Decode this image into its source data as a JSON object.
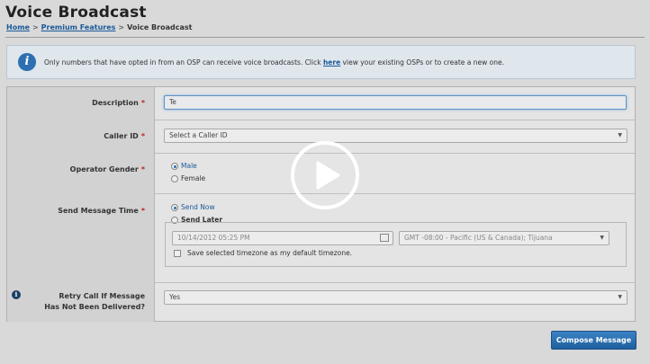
{
  "page": {
    "title": "Voice Broadcast",
    "breadcrumb": {
      "home": "Home",
      "features": "Premium Features",
      "current": "Voice Broadcast",
      "separator": ">"
    }
  },
  "info": {
    "icon": "info-icon",
    "text_before": "Only numbers that have opted in from an OSP can receive voice broadcasts. Click ",
    "link": "here",
    "text_after": " view your existing OSPs or to create a new one."
  },
  "form": {
    "required_mark": "*",
    "description": {
      "label": "Description",
      "value": "Te"
    },
    "caller_id": {
      "label": "Caller ID",
      "value": "Select a Caller ID"
    },
    "gender": {
      "label": "Operator Gender",
      "options": [
        "Male",
        "Female"
      ],
      "selected": "Male"
    },
    "send_time": {
      "label": "Send Message Time",
      "options": [
        "Send Now",
        "Send Later"
      ],
      "selected": "Send Now",
      "datetime": "10/14/2012 05:25 PM",
      "timezone": "GMT -08:00 - Pacific (US & Canada); Tijuana",
      "save_timezone_label": "Save selected timezone as my default timezone."
    },
    "retry": {
      "label_line1": "Retry Call If Message",
      "label_line2": "Has Not Been Delivered?",
      "value": "Yes"
    }
  },
  "actions": {
    "compose": "Compose Message"
  },
  "overlay": {
    "icon": "play-icon"
  },
  "colors": {
    "link": "#1a5a9a",
    "button": "#2a6fb0",
    "required": "#b22222"
  }
}
